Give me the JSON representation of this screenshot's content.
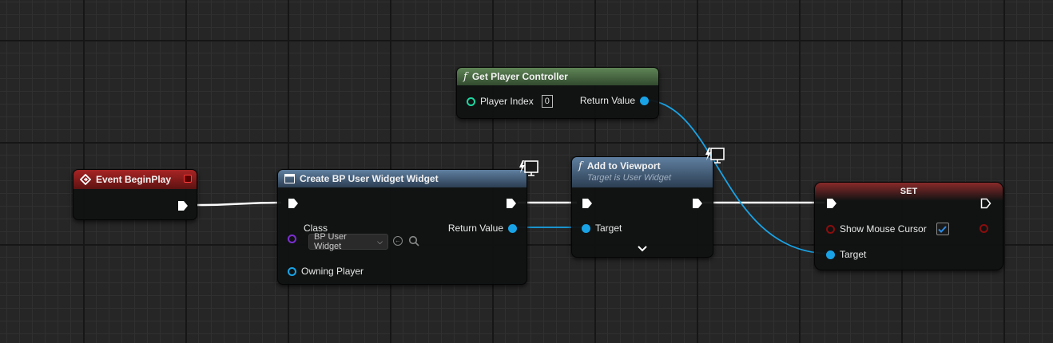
{
  "nodes": {
    "event_begin_play": {
      "title": "Event BeginPlay"
    },
    "get_player_controller": {
      "title": "Get Player Controller",
      "func_icon": "f",
      "player_index_label": "Player Index",
      "player_index_value": "0",
      "return_value_label": "Return Value"
    },
    "create_widget": {
      "title": "Create BP User Widget Widget",
      "class_label": "Class",
      "class_value": "BP User Widget",
      "return_value_label": "Return Value",
      "owning_player_label": "Owning Player"
    },
    "add_to_viewport": {
      "title": "Add to Viewport",
      "func_icon": "f",
      "subtitle": "Target is User Widget",
      "target_label": "Target"
    },
    "set_node": {
      "title": "SET",
      "show_mouse_cursor_label": "Show Mouse Cursor",
      "show_mouse_cursor_checked": true,
      "target_label": "Target"
    }
  },
  "colors": {
    "event_header": "#8c1c1c",
    "function_green_header": "#4f6f46",
    "function_blue_header": "#4d6b8a",
    "set_header": "#7a2020",
    "object_pin": "#19a3e6",
    "class_pin": "#7b2fd1",
    "bool_pin": "#8a0d0d",
    "exec_wire": "#ffffff"
  }
}
